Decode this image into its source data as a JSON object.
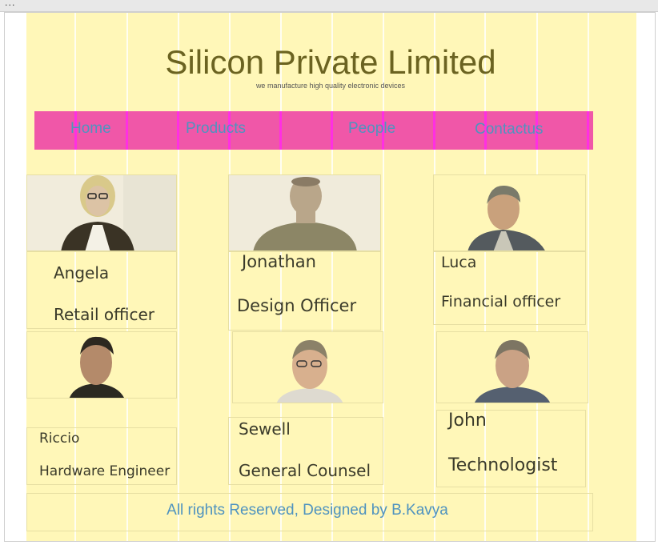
{
  "window": {
    "menu_glyph": "..."
  },
  "header": {
    "title": "Silicon Private Limited",
    "tagline": "we manufacture high quality electronic devices"
  },
  "nav": {
    "items": [
      {
        "label": "Home"
      },
      {
        "label": "Products"
      },
      {
        "label": "People"
      },
      {
        "label": "Contactus"
      }
    ]
  },
  "people": [
    {
      "name": "Angela",
      "role": "Retail officer"
    },
    {
      "name": "Jonathan",
      "role": "Design Officer"
    },
    {
      "name": "Luca",
      "role": "Financial officer"
    },
    {
      "name": "Riccio",
      "role": "Hardware Engineer"
    },
    {
      "name": "Sewell",
      "role": "General Counsel"
    },
    {
      "name": "John",
      "role": "Technologist"
    }
  ],
  "footer": {
    "text": "All rights Reserved, Designed by B.Kavya"
  },
  "colors": {
    "page_bg": "#fff7b8",
    "nav_bg": "#f057a8",
    "nav_text": "#4f93bf",
    "title": "#6b6321"
  }
}
